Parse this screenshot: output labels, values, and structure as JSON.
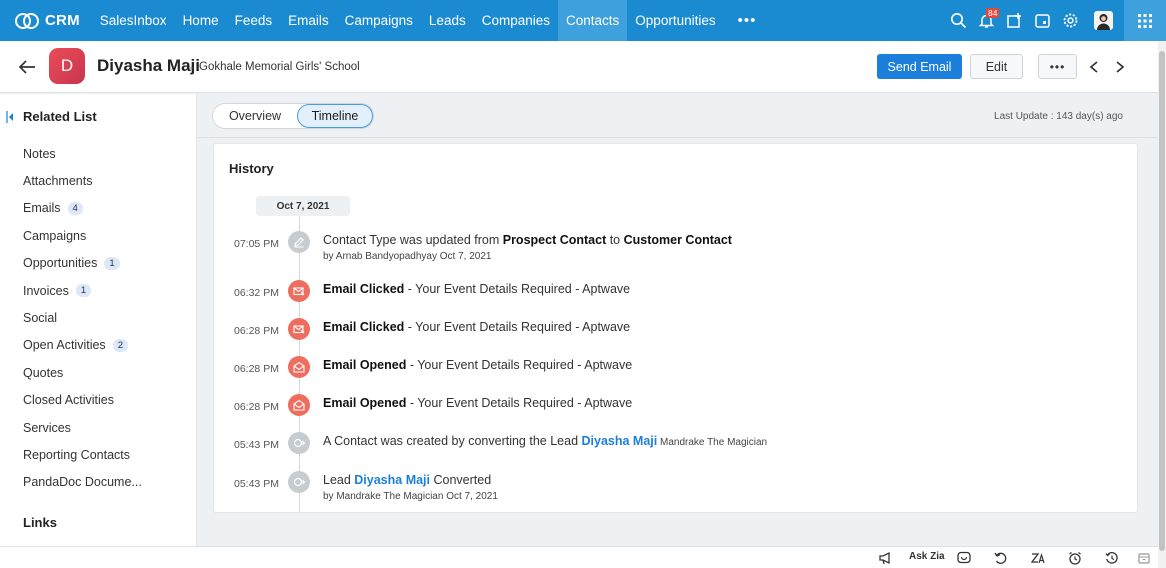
{
  "nav": {
    "brand": "CRM",
    "tabs": [
      {
        "label": "SalesInbox",
        "active": false
      },
      {
        "label": "Home",
        "active": false
      },
      {
        "label": "Feeds",
        "active": false
      },
      {
        "label": "Emails",
        "active": false
      },
      {
        "label": "Campaigns",
        "active": false
      },
      {
        "label": "Leads",
        "active": false
      },
      {
        "label": "Companies",
        "active": false
      },
      {
        "label": "Contacts",
        "active": true
      },
      {
        "label": "Opportunities",
        "active": false
      }
    ],
    "more": "•••",
    "notification_count": "84",
    "accent": "#1b8bd1"
  },
  "record": {
    "initial": "D",
    "name": "Diyasha Maji",
    "separator": "-",
    "account": "Gokhale Memorial Girls' School",
    "send_email": "Send Email",
    "edit": "Edit",
    "more": "•••"
  },
  "sidebar": {
    "related_title": "Related List",
    "items": [
      {
        "label": "Notes",
        "count": ""
      },
      {
        "label": "Attachments",
        "count": ""
      },
      {
        "label": "Emails",
        "count": "4"
      },
      {
        "label": "Campaigns",
        "count": ""
      },
      {
        "label": "Opportunities",
        "count": "1"
      },
      {
        "label": "Invoices",
        "count": "1"
      },
      {
        "label": "Social",
        "count": ""
      },
      {
        "label": "Open Activities",
        "count": "2"
      },
      {
        "label": "Quotes",
        "count": ""
      },
      {
        "label": "Closed Activities",
        "count": ""
      },
      {
        "label": "Services",
        "count": ""
      },
      {
        "label": "Reporting Contacts",
        "count": ""
      },
      {
        "label": "PandaDoc Docume...",
        "count": ""
      }
    ],
    "links_title": "Links"
  },
  "tabs": {
    "overview": "Overview",
    "timeline": "Timeline",
    "last_update": "Last Update : 143 day(s) ago"
  },
  "history": {
    "title": "History",
    "date": "Oct 7, 2021",
    "entries": [
      {
        "time": "07:05 PM",
        "icon": "edit-icon",
        "pre": "Contact Type was updated from ",
        "b1": "Prospect Contact",
        "mid": " to ",
        "b2": "Customer Contact",
        "sub": "by Arnab Bandyopadhyay Oct 7, 2021"
      },
      {
        "time": "06:32 PM",
        "icon": "email-clicked-icon",
        "bold": "Email Clicked",
        "rest": " - Your Event Details Required - Aptwave"
      },
      {
        "time": "06:28 PM",
        "icon": "email-clicked-icon",
        "bold": "Email Clicked",
        "rest": " - Your Event Details Required - Aptwave"
      },
      {
        "time": "06:28 PM",
        "icon": "email-opened-icon",
        "bold": "Email Opened",
        "rest": " - Your Event Details Required - Aptwave"
      },
      {
        "time": "06:28 PM",
        "icon": "email-opened-icon",
        "bold": "Email Opened",
        "rest": " - Your Event Details Required - Aptwave"
      },
      {
        "time": "05:43 PM",
        "icon": "convert-icon",
        "pre": "A Contact was created by converting the Lead ",
        "link": "Diyasha Maji",
        "small": " Mandrake The Magician"
      },
      {
        "time": "05:43 PM",
        "icon": "convert-icon",
        "pre": "Lead ",
        "link": "Diyasha Maji",
        "post": " Converted",
        "sub": "by Mandrake The Magician Oct 7, 2021"
      }
    ]
  },
  "bottom": {
    "ask_zia": "Ask Zia"
  }
}
